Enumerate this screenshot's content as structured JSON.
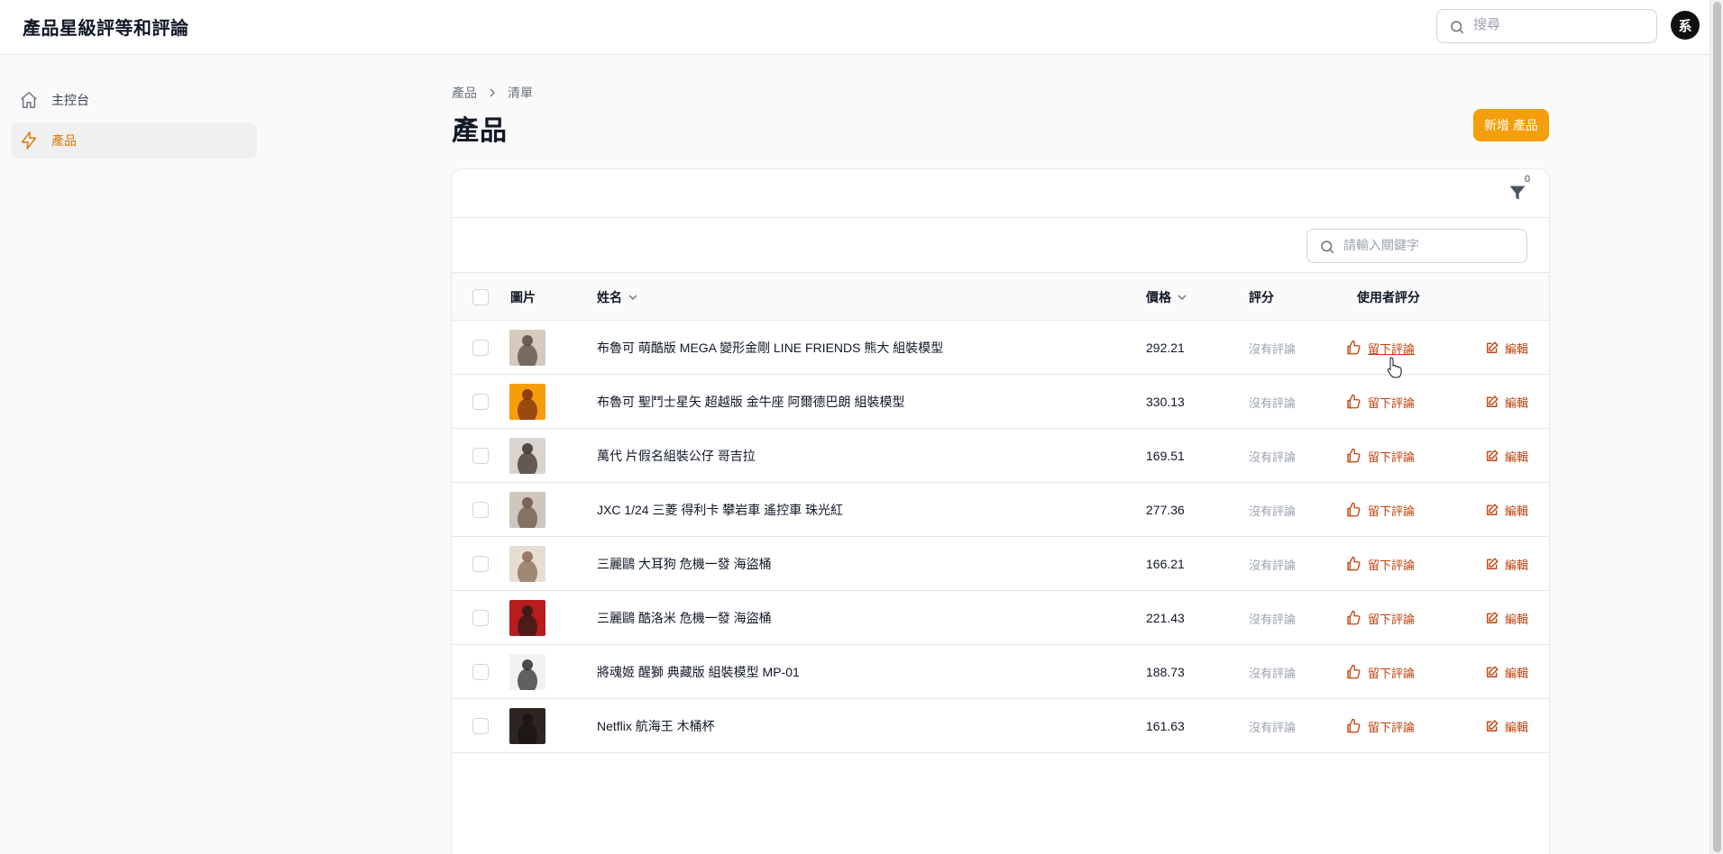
{
  "header": {
    "app_title": "產品星級評等和評論",
    "search_placeholder": "搜尋",
    "avatar_initial": "系"
  },
  "sidebar": {
    "items": [
      {
        "label": "主控台",
        "icon": "home-icon",
        "active": false
      },
      {
        "label": "產品",
        "icon": "lightning-icon",
        "active": true
      }
    ]
  },
  "breadcrumb": [
    "產品",
    "清單"
  ],
  "page": {
    "title": "產品",
    "new_button": "新增 產品"
  },
  "table": {
    "filter_count": "0",
    "search_placeholder": "請輸入關鍵字",
    "columns": {
      "image": "圖片",
      "name": "姓名",
      "price": "價格",
      "rating": "評分",
      "user_rating": "使用者評分"
    },
    "rows": [
      {
        "name": "布魯可 萌酷版 MEGA 變形金剛 LINE FRIENDS 熊大 組裝模型",
        "price": "292.21",
        "rating": "沒有評論",
        "review_action": "留下評論",
        "edit": "編輯"
      },
      {
        "name": "布魯可 聖鬥士星矢 超越版 金牛座 阿爾德巴朗 組裝模型",
        "price": "330.13",
        "rating": "沒有評論",
        "review_action": "留下評論",
        "edit": "編輯"
      },
      {
        "name": "萬代 片假名組裝公仔 哥吉拉",
        "price": "169.51",
        "rating": "沒有評論",
        "review_action": "留下評論",
        "edit": "編輯"
      },
      {
        "name": "JXC 1/24 三菱 得利卡 攀岩車 遙控車 珠光紅",
        "price": "277.36",
        "rating": "沒有評論",
        "review_action": "留下評論",
        "edit": "編輯"
      },
      {
        "name": "三麗鷗 大耳狗 危機一發 海盜桶",
        "price": "166.21",
        "rating": "沒有評論",
        "review_action": "留下評論",
        "edit": "編輯"
      },
      {
        "name": "三麗鷗 酷洛米 危機一發 海盜桶",
        "price": "221.43",
        "rating": "沒有評論",
        "review_action": "留下評論",
        "edit": "編輯"
      },
      {
        "name": "將魂姬 醒獅 典藏版 組裝模型 MP-01",
        "price": "188.73",
        "rating": "沒有評論",
        "review_action": "留下評論",
        "edit": "編輯"
      },
      {
        "name": "Netflix 航海王 木桶杯",
        "price": "161.63",
        "rating": "沒有評論",
        "review_action": "留下評論",
        "edit": "編輯"
      }
    ]
  },
  "colors": {
    "accent": "#f59e0b",
    "action": "#c2410c",
    "active_nav": "#d97706"
  }
}
